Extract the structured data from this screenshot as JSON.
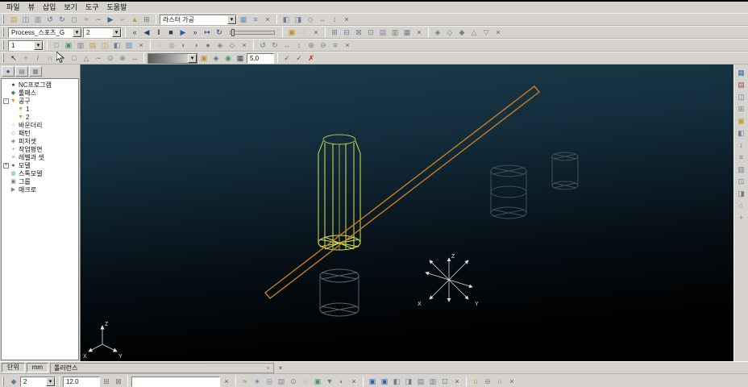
{
  "ui": {
    "dropdown_arrow": "▾"
  },
  "menu": {
    "items": [
      {
        "label": "파일"
      },
      {
        "label": "뷰"
      },
      {
        "label": "삽입"
      },
      {
        "label": "보기"
      },
      {
        "label": "도구"
      },
      {
        "label": "도움말"
      }
    ]
  },
  "combos": {
    "machining": "라스터 가공",
    "process": "Process_스포츠_G",
    "nc_count": "2",
    "level": "1",
    "tolerance_value": "5.0",
    "point_dist": "2",
    "feed": "12.0",
    "command": ""
  },
  "statusbar": {
    "unit_label": "단위",
    "unit_value": "mm",
    "tolerance_label": "톨러런스",
    "pin_glyph": "+",
    "close_glyph": "×"
  },
  "viewport": {
    "axes": {
      "x": "X",
      "y": "Y",
      "z": "Z"
    },
    "tool_color": "#d9e351",
    "stock_color": "#54656e",
    "ghost_color": "#41505a",
    "toolpath_color": "#c97d1f"
  },
  "explorer": {
    "items": [
      {
        "label": "NC프로그램",
        "g": "●",
        "c": "#1f3fae",
        "e": "",
        "ind": 0
      },
      {
        "label": "툴패스",
        "g": "◆",
        "c": "#2e8b57",
        "e": "",
        "ind": 0
      },
      {
        "label": "공구",
        "g": "▼",
        "c": "#d4a017",
        "e": "-",
        "ind": 0
      },
      {
        "label": "1",
        "g": "▼",
        "c": "#d4a017",
        "e": "",
        "ind": 1
      },
      {
        "label": "2",
        "g": "▼",
        "c": "#d4a017",
        "e": "",
        "ind": 1
      },
      {
        "label": "바운더리",
        "g": "○",
        "c": "#8a94a0",
        "e": "",
        "ind": 0
      },
      {
        "label": "패턴",
        "g": "◇",
        "c": "#b08ab0",
        "e": "",
        "ind": 0
      },
      {
        "label": "피처셋",
        "g": "◈",
        "c": "#5f7da3",
        "e": "",
        "ind": 0
      },
      {
        "label": "작업평면",
        "g": "+",
        "c": "#8a94a0",
        "e": "",
        "ind": 0
      },
      {
        "label": "레벨과 셋",
        "g": "≡",
        "c": "#8a94a0",
        "e": "",
        "ind": 0
      },
      {
        "label": "모델",
        "g": "●",
        "c": "#b04040",
        "e": "+",
        "ind": 0
      },
      {
        "label": "스톡모델",
        "g": "◍",
        "c": "#3f9e9e",
        "e": "",
        "ind": 0
      },
      {
        "label": "그룹",
        "g": "▣",
        "c": "#6f7e90",
        "e": "",
        "ind": 0
      },
      {
        "label": "매크로",
        "g": "▶",
        "c": "#a08050",
        "e": "",
        "ind": 0
      }
    ]
  },
  "icons": {
    "panel_tabs": [
      {
        "n": "explorer-tab-icon",
        "g": "●",
        "c": "#2858a8"
      },
      {
        "n": "levels-tab-icon",
        "g": "▤",
        "c": "#6f7e90"
      },
      {
        "n": "clipboard-tab-icon",
        "g": "▦",
        "c": "#6f7e90"
      }
    ],
    "r2a": [
      {
        "n": "open-project-icon",
        "g": "▤",
        "c": "#c19a4b"
      },
      {
        "n": "save-project-icon",
        "g": "◫",
        "c": "#5f7da3"
      },
      {
        "n": "print-icon",
        "g": "▥",
        "c": "#7d8894"
      },
      {
        "n": "undo-icon",
        "g": "↺",
        "c": "#4f6fa0"
      },
      {
        "n": "redo-icon",
        "g": "↻",
        "c": "#4f6fa0"
      },
      {
        "n": "block-setup-icon",
        "g": "◻",
        "c": "#6f86a0"
      },
      {
        "n": "feed-rate-icon",
        "g": "≈",
        "c": "#6f8a5f"
      },
      {
        "n": "toolpath-create-icon",
        "g": "∼",
        "c": "#3f9e5f"
      },
      {
        "n": "simulate-icon",
        "g": "▶",
        "c": "#2f62a8"
      },
      {
        "n": "leads-links-icon",
        "g": "⌐",
        "c": "#7d8894"
      },
      {
        "n": "collision-check-icon",
        "g": "▲",
        "c": "#bd9d3c"
      },
      {
        "n": "options-icon",
        "g": "⊞",
        "c": "#6f7e90"
      }
    ],
    "r2b": [
      {
        "n": "calculate-toolpath-icon",
        "g": "▦",
        "c": "#5f8ec0"
      },
      {
        "n": "batch-process-icon",
        "g": "≡",
        "c": "#6f7e90"
      },
      {
        "n": "machining-close-icon",
        "g": "×",
        "c": "#5a5a5a"
      }
    ],
    "r2c": [
      {
        "n": "shaded-view-icon",
        "g": "◧",
        "c": "#6f7e90"
      },
      {
        "n": "wireframe-view-icon",
        "g": "◨",
        "c": "#6f7e90"
      },
      {
        "n": "iso-view-icon",
        "g": "◇",
        "c": "#6f7e90"
      },
      {
        "n": "pan-view-icon",
        "g": "↔",
        "c": "#6f7e90"
      },
      {
        "n": "zoom-view-icon",
        "g": "↕",
        "c": "#6f7e90"
      },
      {
        "n": "view-toolbar-close-icon",
        "g": "×",
        "c": "#5a5a5a"
      }
    ],
    "r3media": [
      {
        "n": "sim-to-start-icon",
        "g": "«",
        "c": "#1e3f7a"
      },
      {
        "n": "sim-step-back-icon",
        "g": "◀",
        "c": "#1e3f7a"
      },
      {
        "n": "sim-pause-icon",
        "g": "‖",
        "c": "#283848"
      },
      {
        "n": "sim-stop-icon",
        "g": "■",
        "c": "#283848"
      },
      {
        "n": "sim-play-icon",
        "g": "▶",
        "c": "#1e5fae"
      },
      {
        "n": "sim-step-forward-icon",
        "g": "»",
        "c": "#1e3f7a"
      },
      {
        "n": "sim-to-end-icon",
        "g": "↦",
        "c": "#1e3f7a"
      },
      {
        "n": "sim-loop-icon",
        "g": "↻",
        "c": "#1e3f7a"
      }
    ],
    "r3b": [
      {
        "n": "draw-colour-icon",
        "g": "▣",
        "c": "#bd8d2c"
      },
      {
        "n": "translucency-icon",
        "g": "◌",
        "c": "#6f7e90"
      },
      {
        "n": "sim-toolbar-close-icon",
        "g": "×",
        "c": "#5a5a5a"
      }
    ],
    "r3c": [
      {
        "n": "block-show-icon",
        "g": "⊞",
        "c": "#5f7da3"
      },
      {
        "n": "block-hide-icon",
        "g": "⊟",
        "c": "#5f7da3"
      },
      {
        "n": "boundary-edit-icon",
        "g": "⊠",
        "c": "#6f7e90"
      },
      {
        "n": "limit-icon",
        "g": "⊡",
        "c": "#6f7e90"
      },
      {
        "n": "pattern-make-icon",
        "g": "▤",
        "c": "#8a7da0"
      },
      {
        "n": "curve-editor-icon",
        "g": "▥",
        "c": "#6f8a5f"
      },
      {
        "n": "measure-icon",
        "g": "▦",
        "c": "#6f7e90"
      },
      {
        "n": "edit-toolbar-close-icon",
        "g": "×",
        "c": "#5a5a5a"
      }
    ],
    "r3d": [
      {
        "n": "workplane-icon",
        "g": "◈",
        "c": "#5f7da3"
      },
      {
        "n": "workplane-edit-icon",
        "g": "◇",
        "c": "#5f7da3"
      },
      {
        "n": "align-icon",
        "g": "◆",
        "c": "#6f7e90"
      },
      {
        "n": "mirror-icon",
        "g": "△",
        "c": "#6f7e90"
      },
      {
        "n": "rotate-icon",
        "g": "▽",
        "c": "#6f7e90"
      },
      {
        "n": "transform-close-icon",
        "g": "×",
        "c": "#5a5a5a"
      }
    ],
    "r4a": [
      {
        "n": "nc-program-icon",
        "g": "□",
        "c": "#5f7da3"
      },
      {
        "n": "nc-write-icon",
        "g": "▣",
        "c": "#3f9e5f"
      },
      {
        "n": "nc-settings-icon",
        "g": "▥",
        "c": "#6f7e90"
      },
      {
        "n": "tool-database-icon",
        "g": "▤",
        "c": "#bd9d3c"
      },
      {
        "n": "tool-edit-icon",
        "g": "◫",
        "c": "#bd9d3c"
      },
      {
        "n": "feeds-icon",
        "g": "◧",
        "c": "#6f7e90"
      },
      {
        "n": "coolant-icon",
        "g": "▨",
        "c": "#4f8fae"
      },
      {
        "n": "nc-toolbar-close-icon",
        "g": "×",
        "c": "#5a5a5a"
      }
    ],
    "r4b": [
      {
        "n": "boundary-create-icon",
        "g": "○",
        "c": "#9aa4ae"
      },
      {
        "n": "boundary-block-icon",
        "g": "◍",
        "c": "#9aa4ae"
      },
      {
        "n": "boundary-rest-icon",
        "g": "◐",
        "c": "#6f7e90"
      },
      {
        "n": "boundary-shallow-icon",
        "g": "◑",
        "c": "#6f7e90"
      },
      {
        "n": "boundary-silhouette-icon",
        "g": "●",
        "c": "#6f7e90"
      },
      {
        "n": "pattern-icon",
        "g": "◈",
        "c": "#8a7da0"
      },
      {
        "n": "feature-set-icon",
        "g": "◇",
        "c": "#5f7da3"
      },
      {
        "n": "boundary-toolbar-close-icon",
        "g": "×",
        "c": "#5a5a5a"
      }
    ],
    "r4c": [
      {
        "n": "undo-view-icon",
        "g": "↺",
        "c": "#5f7da3"
      },
      {
        "n": "redo-view-icon",
        "g": "↻",
        "c": "#5f7da3"
      },
      {
        "n": "view-left-right-icon",
        "g": "↔",
        "c": "#6f7e90"
      },
      {
        "n": "view-up-down-icon",
        "g": "↕",
        "c": "#6f7e90"
      },
      {
        "n": "zoom-in-icon",
        "g": "⊕",
        "c": "#6f7e90"
      },
      {
        "n": "zoom-out-icon",
        "g": "⊖",
        "c": "#6f7e90"
      },
      {
        "n": "refresh-icon",
        "g": "≡",
        "c": "#6f7e90"
      },
      {
        "n": "view2-toolbar-close-icon",
        "g": "×",
        "c": "#5a5a5a"
      }
    ],
    "r5a": [
      {
        "n": "select-cursor-icon",
        "g": "↖",
        "c": "#1c1c1c"
      },
      {
        "n": "create-point-icon",
        "g": "+",
        "c": "#6f7e90"
      },
      {
        "n": "create-line-icon",
        "g": "/",
        "c": "#6f7e90"
      },
      {
        "n": "create-arc-icon",
        "g": "∩",
        "c": "#6f7e90"
      },
      {
        "n": "create-circle-icon",
        "g": "○",
        "c": "#6f7e90"
      },
      {
        "n": "create-rect-icon",
        "g": "□",
        "c": "#6f7e90"
      },
      {
        "n": "create-polygon-icon",
        "g": "△",
        "c": "#6f7e90"
      },
      {
        "n": "create-curve-icon",
        "g": "∼",
        "c": "#3f9e5f"
      },
      {
        "n": "offset-icon",
        "g": "⊙",
        "c": "#6f7e90"
      },
      {
        "n": "trim-icon",
        "g": "⊗",
        "c": "#6f7e90"
      },
      {
        "n": "dimension-icon",
        "g": "↔",
        "c": "#6f7e90"
      }
    ],
    "r5c": [
      {
        "n": "curve-colour-icon",
        "g": "▣",
        "c": "#bd8d2c"
      },
      {
        "n": "surface-icon",
        "g": "◈",
        "c": "#4f6fa0"
      },
      {
        "n": "mesh-icon",
        "g": "◉",
        "c": "#3f9e5f"
      },
      {
        "n": "tolerance-grid-icon",
        "g": "▦",
        "c": "#3a4a5a"
      }
    ],
    "r5d": [
      {
        "n": "accept-icon",
        "g": "✓",
        "c": "#1f8a1f"
      },
      {
        "n": "apply-icon",
        "g": "✓",
        "c": "#1f8a1f"
      },
      {
        "n": "cancel-icon",
        "g": "✗",
        "c": "#c02020"
      }
    ],
    "rv": [
      {
        "n": "rv-explorer-icon",
        "g": "▦",
        "c": "#3f6fae"
      },
      {
        "n": "rv-levels-icon",
        "g": "▤",
        "c": "#a04848"
      },
      {
        "n": "rv-views-icon",
        "g": "◫",
        "c": "#5f7da3"
      },
      {
        "n": "rv-block-icon",
        "g": "⊞",
        "c": "#6f7e90"
      },
      {
        "n": "rv-tool-icon",
        "g": "▣",
        "c": "#bd9d3c"
      },
      {
        "n": "rv-shade-icon",
        "g": "◧",
        "c": "#6f7e90"
      },
      {
        "n": "rv-zoom-icon",
        "g": "↕",
        "c": "#6f7e90"
      },
      {
        "n": "rv-list-icon",
        "g": "≡",
        "c": "#6f7e90"
      },
      {
        "n": "rv-grid-icon",
        "g": "▥",
        "c": "#6f7e90"
      },
      {
        "n": "rv-limits-icon",
        "g": "⊡",
        "c": "#6f7e90"
      },
      {
        "n": "rv-half-icon",
        "g": "◨",
        "c": "#6f7e90"
      },
      {
        "n": "rv-circle-icon",
        "g": "○",
        "c": "#6f7e90"
      },
      {
        "n": "rv-plus-icon",
        "g": "+",
        "c": "#6f7e90"
      }
    ],
    "bt1": [
      {
        "n": "snap-mode-icon",
        "g": "◆",
        "c": "#5f7da3"
      }
    ],
    "bt3": [
      {
        "n": "grid-on-icon",
        "g": "⊞",
        "c": "#6f7e90"
      },
      {
        "n": "grid-off-icon",
        "g": "⊠",
        "c": "#6f7e90"
      }
    ],
    "bt4": [
      {
        "n": "raster-strategy-icon",
        "g": "≈",
        "c": "#3f9e5f"
      },
      {
        "n": "radial-strategy-icon",
        "g": "∗",
        "c": "#5f7da3"
      },
      {
        "n": "spiral-strategy-icon",
        "g": "◎",
        "c": "#5f7da3"
      },
      {
        "n": "pattern-strategy-icon",
        "g": "▤",
        "c": "#8a7da0"
      },
      {
        "n": "offset-strategy-icon",
        "g": "⊙",
        "c": "#6f7e90"
      },
      {
        "n": "profile-strategy-icon",
        "g": "○",
        "c": "#bd9d3c"
      },
      {
        "n": "area-clear-icon",
        "g": "▣",
        "c": "#3f9e5f"
      },
      {
        "n": "drill-icon",
        "g": "▼",
        "c": "#6f7e90"
      },
      {
        "n": "rest-machining-icon",
        "g": "◐",
        "c": "#6f7e90"
      },
      {
        "n": "strategy-close-icon",
        "g": "×",
        "c": "#5a5a5a"
      }
    ],
    "bt5": [
      {
        "n": "show-toolpath-check-icon",
        "g": "▣",
        "c": "#2f62a8"
      },
      {
        "n": "show-tool-check-icon",
        "g": "▣",
        "c": "#2f62a8"
      },
      {
        "n": "show-block-icon",
        "g": "◧",
        "c": "#6f7e90"
      },
      {
        "n": "show-model-icon",
        "g": "◨",
        "c": "#6f7e90"
      },
      {
        "n": "show-boundary-icon",
        "g": "▤",
        "c": "#6f7e90"
      },
      {
        "n": "show-pattern-icon",
        "g": "▥",
        "c": "#6f7e90"
      },
      {
        "n": "show-limits-icon",
        "g": "⊡",
        "c": "#6f7e90"
      },
      {
        "n": "display-close-icon",
        "g": "×",
        "c": "#5a5a5a"
      }
    ],
    "bt6": [
      {
        "n": "union-icon",
        "g": "∪",
        "c": "#bd9d3c"
      },
      {
        "n": "subtract-icon",
        "g": "⊖",
        "c": "#6f7e90"
      },
      {
        "n": "intersect-icon",
        "g": "∩",
        "c": "#6f7e90"
      },
      {
        "n": "boolean-close-icon",
        "g": "×",
        "c": "#5a5a5a"
      }
    ]
  }
}
